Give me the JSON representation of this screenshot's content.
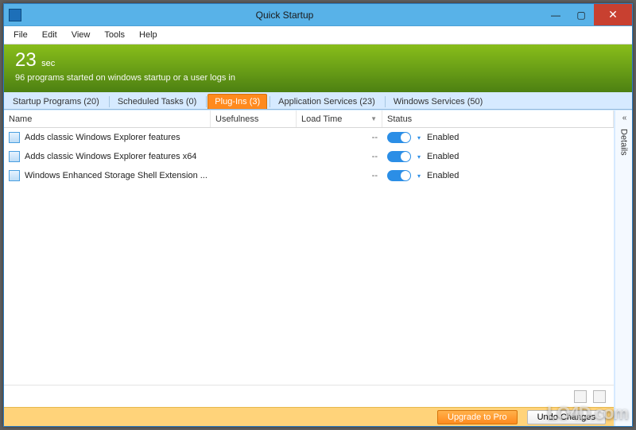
{
  "window": {
    "title": "Quick Startup"
  },
  "menu": {
    "file": "File",
    "edit": "Edit",
    "view": "View",
    "tools": "Tools",
    "help": "Help"
  },
  "banner": {
    "number": "23",
    "unit": "sec",
    "sub": "96 programs started on windows startup or a user logs in"
  },
  "tabs": [
    {
      "label": "Startup Programs (20)"
    },
    {
      "label": "Scheduled Tasks (0)"
    },
    {
      "label": "Plug-Ins (3)"
    },
    {
      "label": "Application Services (23)"
    },
    {
      "label": "Windows Services (50)"
    }
  ],
  "active_tab_index": 2,
  "columns": {
    "name": "Name",
    "usefulness": "Usefulness",
    "loadtime": "Load Time",
    "status": "Status"
  },
  "rows": [
    {
      "name": "Adds classic Windows Explorer features",
      "usefulness": "",
      "loadtime": "--",
      "status": "Enabled",
      "enabled": true
    },
    {
      "name": "Adds classic Windows Explorer features x64",
      "usefulness": "",
      "loadtime": "--",
      "status": "Enabled",
      "enabled": true
    },
    {
      "name": "Windows Enhanced Storage Shell Extension ...",
      "usefulness": "",
      "loadtime": "--",
      "status": "Enabled",
      "enabled": true
    }
  ],
  "sidepanel": {
    "label": "Details"
  },
  "footer": {
    "upgrade": "Upgrade to Pro",
    "undo": "Undo Changes"
  },
  "watermark": "LO4D.com"
}
